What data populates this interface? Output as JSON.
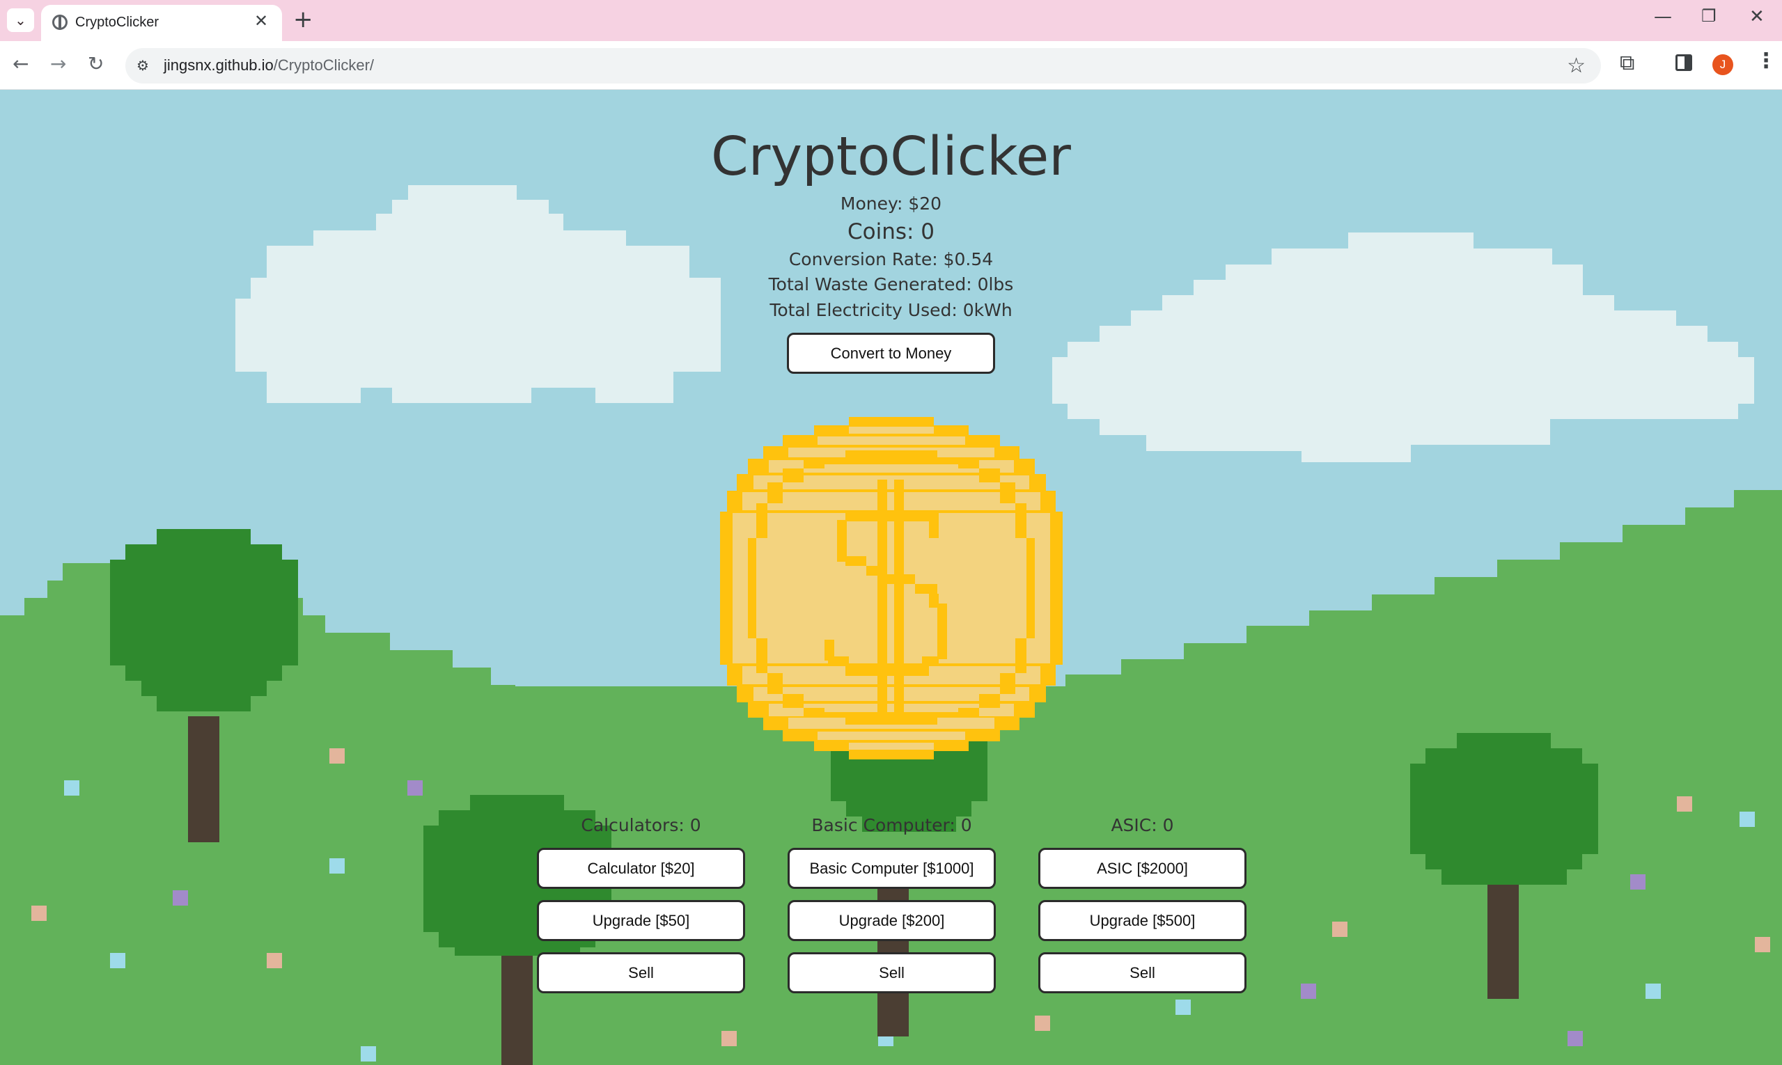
{
  "browser": {
    "tab_title": "CryptoClicker",
    "new_tab_symbol": "+",
    "close_tab_symbol": "✕",
    "url_host": "jingsnx.github.io",
    "url_path": "/CryptoClicker/",
    "avatar_initial": "J"
  },
  "game": {
    "title": "CryptoClicker",
    "money": "Money: $20",
    "coins": "Coins: 0",
    "conversion_rate": "Conversion Rate: $0.54",
    "waste": "Total Waste Generated: 0lbs",
    "electricity": "Total Electricity Used: 0kWh",
    "convert_button": "Convert to Money"
  },
  "shop": [
    {
      "count": "Calculators: 0",
      "buy": "Calculator [$20]",
      "upgrade": "Upgrade [$50]",
      "sell": "Sell"
    },
    {
      "count": "Basic Computer: 0",
      "buy": "Basic Computer [$1000]",
      "upgrade": "Upgrade [$200]",
      "sell": "Sell"
    },
    {
      "count": "ASIC: 0",
      "buy": "ASIC [$2000]",
      "upgrade": "Upgrade [$500]",
      "sell": "Sell"
    }
  ],
  "colors": {
    "sky": "#a2d4df",
    "cloud": "#e2f0f1",
    "grass": "#62b25a",
    "grass_dark": "#57a54f",
    "tree": "#2f8a2e",
    "trunk": "#4b3e33",
    "coin_outer": "#ffc20e",
    "coin_inner": "#f3d37f",
    "chrome_tab_bar": "#f6d2e2"
  }
}
